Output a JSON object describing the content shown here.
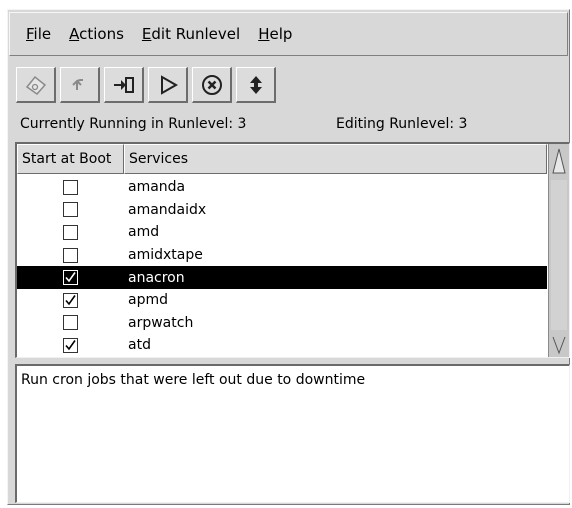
{
  "menubar": {
    "items": [
      {
        "label": "File",
        "accel": "F",
        "rest": "ile"
      },
      {
        "label": "Actions",
        "accel": "A",
        "rest": "ctions"
      },
      {
        "label": "Edit Runlevel",
        "accel": "E",
        "rest": "dit Runlevel"
      },
      {
        "label": "Help",
        "accel": "H",
        "rest": "elp"
      }
    ]
  },
  "toolbar": {
    "buttons": [
      {
        "icon": "save-icon"
      },
      {
        "icon": "revert-icon"
      },
      {
        "icon": "add-service-icon"
      },
      {
        "icon": "start-icon"
      },
      {
        "icon": "stop-icon"
      },
      {
        "icon": "restart-icon"
      }
    ]
  },
  "status": {
    "running": "Currently Running in Runlevel: 3",
    "editing": "Editing Runlevel: 3"
  },
  "table": {
    "headers": [
      "Start at Boot",
      "Services"
    ],
    "rows": [
      {
        "name": "amanda",
        "checked": false,
        "selected": false
      },
      {
        "name": "amandaidx",
        "checked": false,
        "selected": false
      },
      {
        "name": "amd",
        "checked": false,
        "selected": false
      },
      {
        "name": "amidxtape",
        "checked": false,
        "selected": false
      },
      {
        "name": "anacron",
        "checked": true,
        "selected": true
      },
      {
        "name": "apmd",
        "checked": true,
        "selected": false
      },
      {
        "name": "arpwatch",
        "checked": false,
        "selected": false
      },
      {
        "name": "atd",
        "checked": true,
        "selected": false
      }
    ]
  },
  "description": "Run cron jobs that were left out due to downtime"
}
